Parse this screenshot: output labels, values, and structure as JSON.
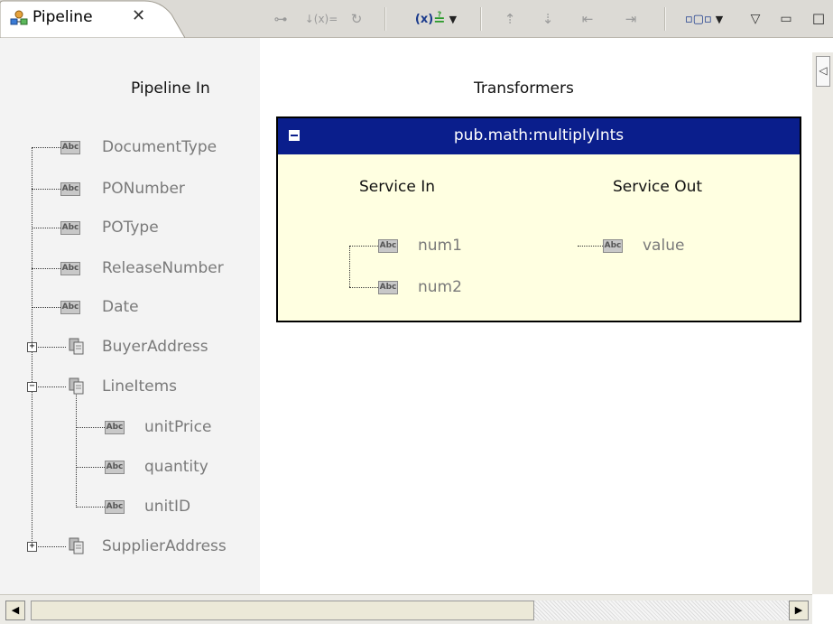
{
  "tab": {
    "title": "Pipeline",
    "close_symbol": "✕"
  },
  "toolbar": [
    {
      "name": "link-icon",
      "glyph": "⊶"
    },
    {
      "name": "drop-variable-icon",
      "glyph": "↓(x)="
    },
    {
      "name": "refresh-icon",
      "glyph": "↻"
    },
    {
      "name": "set-value-icon",
      "glyph": "(x)="
    },
    {
      "name": "up-icon",
      "glyph": "⇡"
    },
    {
      "name": "down-icon",
      "glyph": "⇣"
    },
    {
      "name": "left-icon",
      "glyph": "⇤"
    },
    {
      "name": "right-icon",
      "glyph": "⇥"
    },
    {
      "name": "view-mode-icon",
      "glyph": "▫▢▫"
    }
  ],
  "pipeline_in": {
    "title": "Pipeline In",
    "nodes": [
      {
        "label": "DocumentType",
        "type": "string"
      },
      {
        "label": "PONumber",
        "type": "string"
      },
      {
        "label": "POType",
        "type": "string"
      },
      {
        "label": "ReleaseNumber",
        "type": "string"
      },
      {
        "label": "Date",
        "type": "string"
      },
      {
        "label": "BuyerAddress",
        "type": "document",
        "expander": "+"
      },
      {
        "label": "LineItems",
        "type": "document",
        "expander": "−"
      },
      {
        "label": "unitPrice",
        "type": "string"
      },
      {
        "label": "quantity",
        "type": "string"
      },
      {
        "label": "unitID",
        "type": "string"
      },
      {
        "label": "SupplierAddress",
        "type": "document",
        "expander": "+"
      }
    ]
  },
  "transformers": {
    "title": "Transformers",
    "service": {
      "name": "pub.math:multiplyInts",
      "service_in": {
        "title": "Service In",
        "fields": [
          "num1",
          "num2"
        ]
      },
      "service_out": {
        "title": "Service Out",
        "fields": [
          "value"
        ]
      }
    }
  },
  "abc_icon_text": "Abc",
  "colors": {
    "service_header": "#0a1e8c",
    "service_body": "#ffffe1",
    "tree_label": "#7a7a7a"
  }
}
